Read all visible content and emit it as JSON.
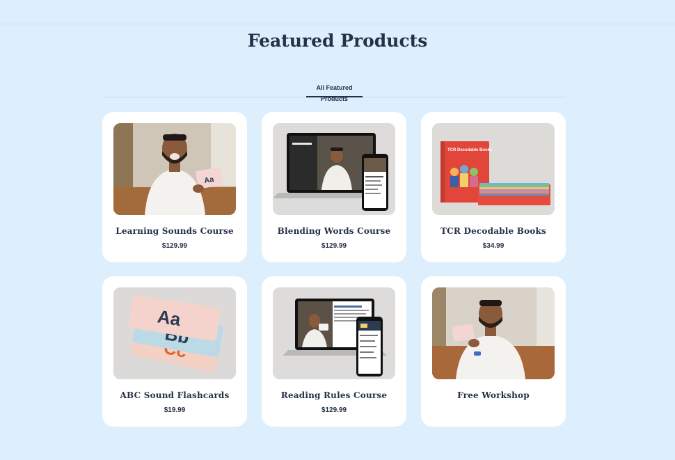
{
  "section": {
    "title": "Featured Products"
  },
  "tabs": [
    {
      "label": "All Featured Products",
      "active": true
    }
  ],
  "products": [
    {
      "name": "Learning Sounds Course",
      "price": "$129.99",
      "image": "man-holding-flashcard-photo"
    },
    {
      "name": "Blending Words Course",
      "price": "$129.99",
      "image": "laptop-and-phone-course-mockup"
    },
    {
      "name": "TCR Decodable Books",
      "price": "$34.99",
      "image": "decodable-books-set",
      "image_text": {
        "cover_title": "TCR Decodable Books"
      }
    },
    {
      "name": "ABC Sound Flashcards",
      "price": "$19.99",
      "image": "alphabet-flashcards",
      "image_text": {
        "card1": "Aa",
        "card2": "Bb",
        "card3": "Cc"
      }
    },
    {
      "name": "Reading Rules Course",
      "price": "$129.99",
      "image": "laptop-and-phone-course-mockup"
    },
    {
      "name": "Free Workshop",
      "price": "",
      "image": "man-holding-card-on-couch-photo"
    }
  ],
  "colors": {
    "page_bg": "#ddeefc",
    "card_bg": "#ffffff",
    "text": "#243149",
    "thumb_bg": "#d9dad8"
  }
}
